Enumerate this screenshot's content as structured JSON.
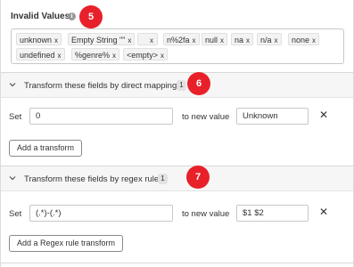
{
  "invalid_values": {
    "label": "Invalid Values:",
    "info_icon": "info-icon",
    "badge": "5",
    "tags": [
      {
        "text": "unknown",
        "remove": "x"
      },
      {
        "text": "Empty String \"\"",
        "remove": "x"
      },
      {
        "text": "",
        "remove": "x"
      },
      {
        "text": "n%2fa",
        "remove": "x"
      },
      {
        "text": "null",
        "remove": "x"
      },
      {
        "text": "na",
        "remove": "x"
      },
      {
        "text": "n/a",
        "remove": "x"
      },
      {
        "text": "none",
        "remove": "x"
      },
      {
        "text": "undefined",
        "remove": "x"
      },
      {
        "text": "%genre%",
        "remove": "x"
      },
      {
        "text": "<empty>",
        "remove": "x"
      }
    ]
  },
  "direct_mapping": {
    "title": "Transform these fields by direct mapping:",
    "count": "1",
    "badge": "6",
    "set_label": "Set",
    "set_value": "0",
    "to_label": "to new value",
    "new_value": "Unknown",
    "remove": "✕",
    "add_button": "Add a transform"
  },
  "regex_rule": {
    "title": "Transform these fields by regex rule:",
    "count": "1",
    "badge": "7",
    "set_label": "Set",
    "set_value": "(.*)-(.*)",
    "to_label": "to new value",
    "new_value": "$1 $2",
    "remove": "✕",
    "add_button": "Add a Regex rule transform"
  },
  "colors": {
    "badge": "#e8202a",
    "header_bg": "#f6f6f6"
  }
}
